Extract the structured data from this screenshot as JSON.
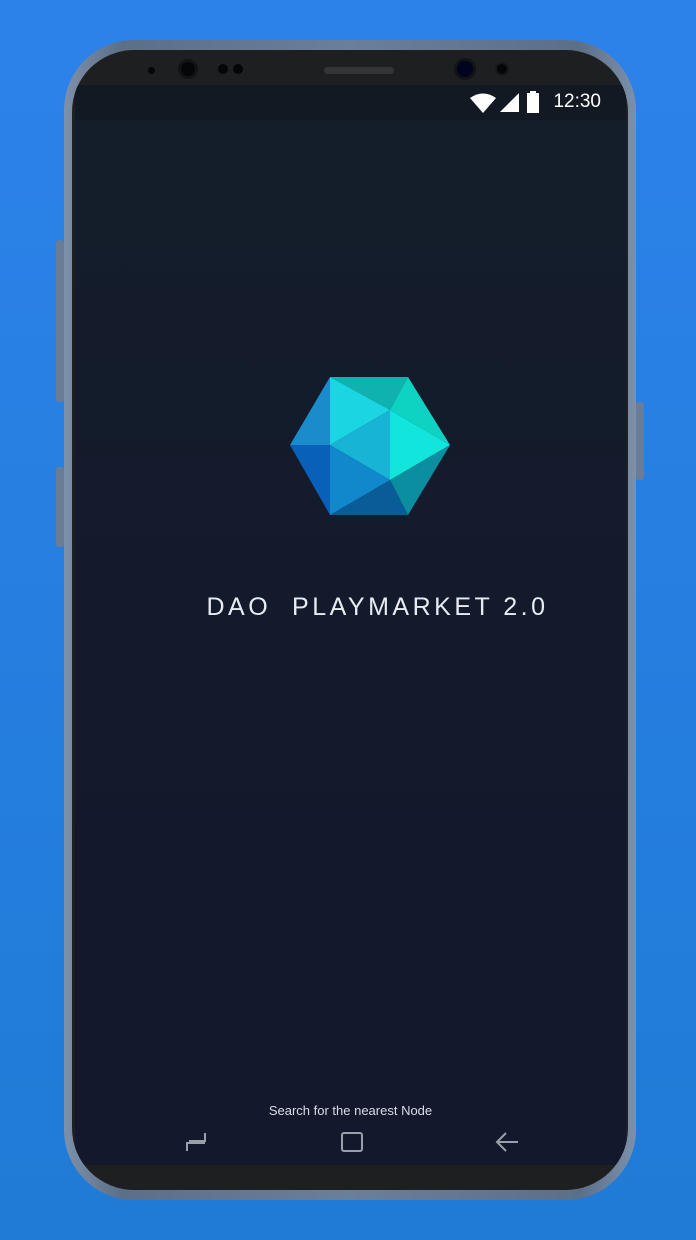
{
  "status_bar": {
    "time": "12:30",
    "icons": [
      "wifi-icon",
      "signal-icon",
      "battery-icon"
    ]
  },
  "app": {
    "title": "DAO  PLAYMARKET 2.0",
    "status_message": "Search for the nearest Node",
    "logo": "hexagon-crystal-logo"
  },
  "nav_bar": {
    "icons": [
      "recent-apps-icon",
      "home-icon",
      "back-icon"
    ]
  },
  "colors": {
    "background": "#2d82ea",
    "screen": "#131a2c",
    "logo_cyan": "#12e6dc",
    "logo_blue": "#0860b8"
  }
}
